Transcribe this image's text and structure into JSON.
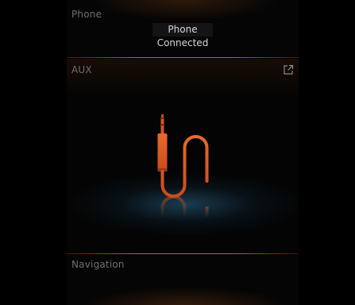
{
  "phone": {
    "label": "Phone",
    "device_name": "Phone",
    "status": "Connected"
  },
  "aux": {
    "label": "AUX",
    "graphic_icon": "aux-cable-icon",
    "open_icon": "open-external-icon"
  },
  "navigation": {
    "label": "Navigation"
  },
  "colors": {
    "accent": "#e0642a",
    "label": "#6f6f73",
    "text": "#d6d6d8",
    "glow": "#1e465f"
  }
}
